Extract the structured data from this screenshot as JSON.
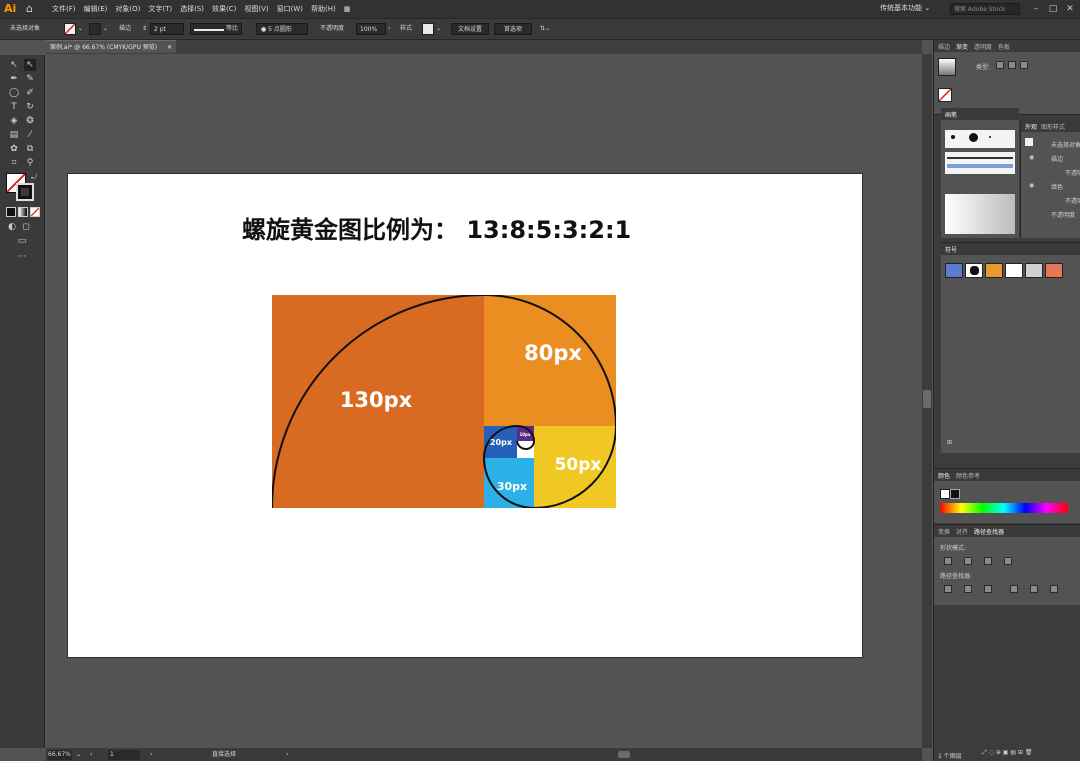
{
  "app": {
    "logo": "Ai",
    "menus": [
      "文件(F)",
      "编辑(E)",
      "对象(O)",
      "文字(T)",
      "选择(S)",
      "效果(C)",
      "视图(V)",
      "窗口(W)",
      "帮助(H)"
    ],
    "workspace": "传统基本功能",
    "search_placeholder": "搜索 Adobe Stock"
  },
  "control_bar": {
    "selection_status": "未选择对象",
    "stroke_label": "描边",
    "stroke_weight": "2 pt",
    "stroke_profile": "等比",
    "brush": "5 点圆形",
    "opacity_label": "不透明度",
    "opacity_value": "100%",
    "style_label": "样式",
    "doc_setup_button": "文档设置",
    "preferences_button": "首选项"
  },
  "document": {
    "tab_title": "案例.ai* @ 66.67% (CMYK/GPU 预览)"
  },
  "artboard": {
    "headline": "螺旋黄金图比例为：  13:8:5:3:2:1",
    "blocks": [
      {
        "label": "130px",
        "color": "#d96a22"
      },
      {
        "label": "80px",
        "color": "#ea8e22"
      },
      {
        "label": "50px",
        "color": "#f1c823"
      },
      {
        "label": "30px",
        "color": "#2db0e6"
      },
      {
        "label": "20px",
        "color": "#2660b8"
      },
      {
        "label": "10px",
        "color": "#5a2c8a"
      }
    ]
  },
  "status_bar": {
    "zoom": "66.67%",
    "artboard_number": "1",
    "tool_status": "直接选择"
  },
  "panels": {
    "top_tabs": [
      "描边",
      "渐变",
      "透明度",
      "色板"
    ],
    "gradient_type_label": "类型:",
    "brushes_tab": "画笔",
    "appearance_tabs": [
      "外观",
      "图形样式"
    ],
    "appearance_rows": [
      "未选择对象",
      "描边",
      "不透明度",
      "填色",
      "不透明度",
      "不透明度"
    ],
    "symbols_tab": "符号",
    "color_tabs": [
      "颜色",
      "颜色参考"
    ],
    "pathfinder_tabs": [
      "变换",
      "对齐",
      "路径查找器"
    ],
    "shape_modes_label": "形状模式:",
    "pathfinder_label": "路径查找器:",
    "layers_count": "1 个图层"
  },
  "colors": {
    "accent": "#ff9a00",
    "canvas": "#535353"
  }
}
